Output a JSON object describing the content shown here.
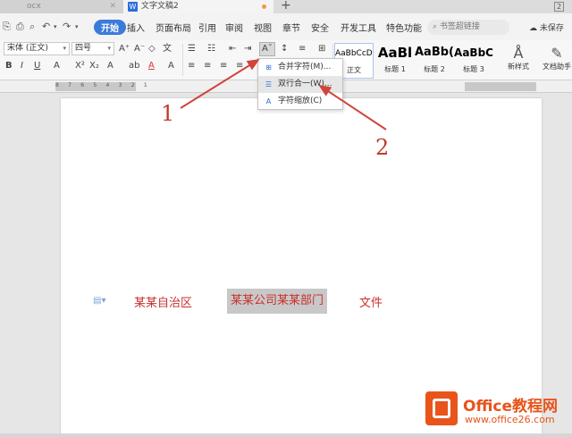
{
  "tabs": {
    "left_label": "ocx",
    "active_label": "文字文稿2",
    "new_tab": "+",
    "window_count": "2"
  },
  "menu": {
    "quick_undo": "↶",
    "quick_redo": "↷",
    "items": [
      "开始",
      "插入",
      "页面布局",
      "引用",
      "审阅",
      "视图",
      "章节",
      "安全",
      "开发工具",
      "特色功能"
    ],
    "search_placeholder": "书签超链接",
    "unsaved": "未保存"
  },
  "ribbon": {
    "font_name": "宋体 (正文)",
    "font_size": "四号",
    "styles": [
      {
        "sample": "AaBbCcDd",
        "label": "正文"
      },
      {
        "sample": "AaBl",
        "label": "标题 1"
      },
      {
        "sample": "AaBb(",
        "label": "标题 2"
      },
      {
        "sample": "AaBbC",
        "label": "标题 3"
      }
    ],
    "new_style": "新样式",
    "doc_assistant": "文档助手"
  },
  "dropdown": {
    "items": [
      "合并字符(M)...",
      "双行合一(W)...",
      "字符缩放(C)"
    ]
  },
  "ruler": {
    "ticks": "8 7 6 5 4 3 2 1"
  },
  "document": {
    "text_left": "某某自治区",
    "text_selected": "某某公司某某部门",
    "text_right": "文件"
  },
  "annotations": {
    "label_1": "1",
    "label_2": "2",
    "color": "#c0392b"
  },
  "watermark": {
    "title": "Office教程网",
    "url": "www.office26.com"
  }
}
